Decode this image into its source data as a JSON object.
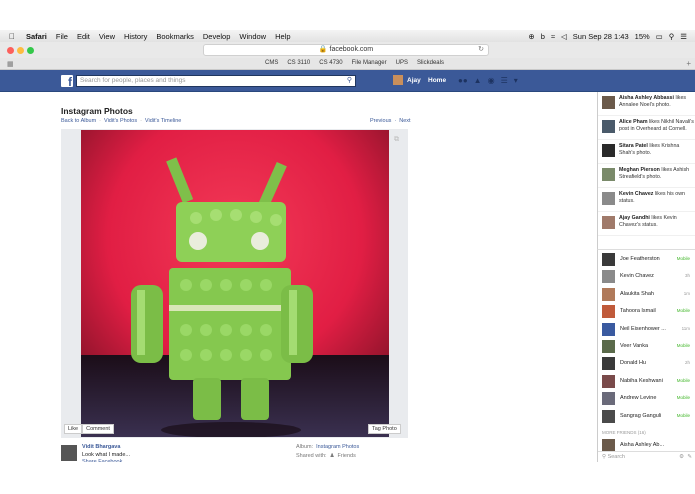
{
  "menubar": {
    "apple": "",
    "app": "Safari",
    "items": [
      "File",
      "Edit",
      "View",
      "History",
      "Bookmarks",
      "Develop",
      "Window",
      "Help"
    ],
    "datetime": "Sun Sep 28 1:43",
    "battery": "15%"
  },
  "browser": {
    "url": "facebook.com",
    "favorites": [
      "CMS",
      "CS 3110",
      "CS 4730",
      "File Manager",
      "UPS",
      "Slickdeals"
    ]
  },
  "fb": {
    "logo": "f",
    "search_placeholder": "Search for people, places and things",
    "user_name": "Ajay",
    "home_label": "Home"
  },
  "photo_page": {
    "title": "Instagram Photos",
    "crumbs": [
      "Back to Album",
      "Vidit's Photos",
      "Vidit's Timeline"
    ],
    "previous": "Previous",
    "next": "Next",
    "like_label": "Like",
    "comment_label": "Comment",
    "tag_label": "Tag Photo",
    "poster_name": "Vidit Bhargava",
    "caption": "Look what I made...",
    "caption_cut": "Share Facebook",
    "album_label": "Album:",
    "album_name": "Instagram Photos",
    "shared_label": "Shared with:",
    "shared_value": "Friends"
  },
  "ticker": [
    {
      "name": "Aisha Ashley Abbassi",
      "text": "likes Annalee Noel's photo.",
      "color": "#6b5a4a"
    },
    {
      "name": "Alice Pham",
      "text": "likes Nikhil Navali's post in Overheard at Cornell.",
      "color": "#4a5a6a"
    },
    {
      "name": "Sitara Patel",
      "text": "likes Krishna Shah's photo.",
      "color": "#2a2a2a"
    },
    {
      "name": "Meghan Pierson",
      "text": "likes Ashish Streafield's photo.",
      "color": "#7a8a6a"
    },
    {
      "name": "Kevin Chavez",
      "text": "likes his own status.",
      "color": "#8a8a8a"
    },
    {
      "name": "Ajay Gandhi",
      "text": "likes Kevin Chavez's status.",
      "color": "#a07a6a"
    }
  ],
  "chat": [
    {
      "name": "Joe Featherston",
      "status": "Mobile",
      "mobile": true,
      "color": "#3a3a3a"
    },
    {
      "name": "Kevin Chavez",
      "status": "3h",
      "mobile": false,
      "color": "#8a8a8a"
    },
    {
      "name": "Alaukita Shah",
      "status": "1m",
      "mobile": false,
      "color": "#b07a5a"
    },
    {
      "name": "Tahoora Ismail",
      "status": "Mobile",
      "mobile": true,
      "color": "#c05a3a"
    },
    {
      "name": "Neil Eisenhower ...",
      "status": "11m",
      "mobile": false,
      "color": "#3a5aa0"
    },
    {
      "name": "Veer Vanka",
      "status": "Mobile",
      "mobile": true,
      "color": "#5a6a4a"
    },
    {
      "name": "Donald Hu",
      "status": "2h",
      "mobile": false,
      "color": "#3a3a3a"
    },
    {
      "name": "Nabiha Keshwani",
      "status": "Mobile",
      "mobile": true,
      "color": "#7a4a4a"
    },
    {
      "name": "Andrew Levine",
      "status": "Mobile",
      "mobile": true,
      "color": "#6a6a7a"
    },
    {
      "name": "Sangrag Ganguli",
      "status": "Mobile",
      "mobile": true,
      "color": "#4a4a4a"
    }
  ],
  "more_friends": "MORE FRIENDS (16)",
  "more_friend_1": "Aisha Ashley Ab...",
  "chat_search": "Search"
}
